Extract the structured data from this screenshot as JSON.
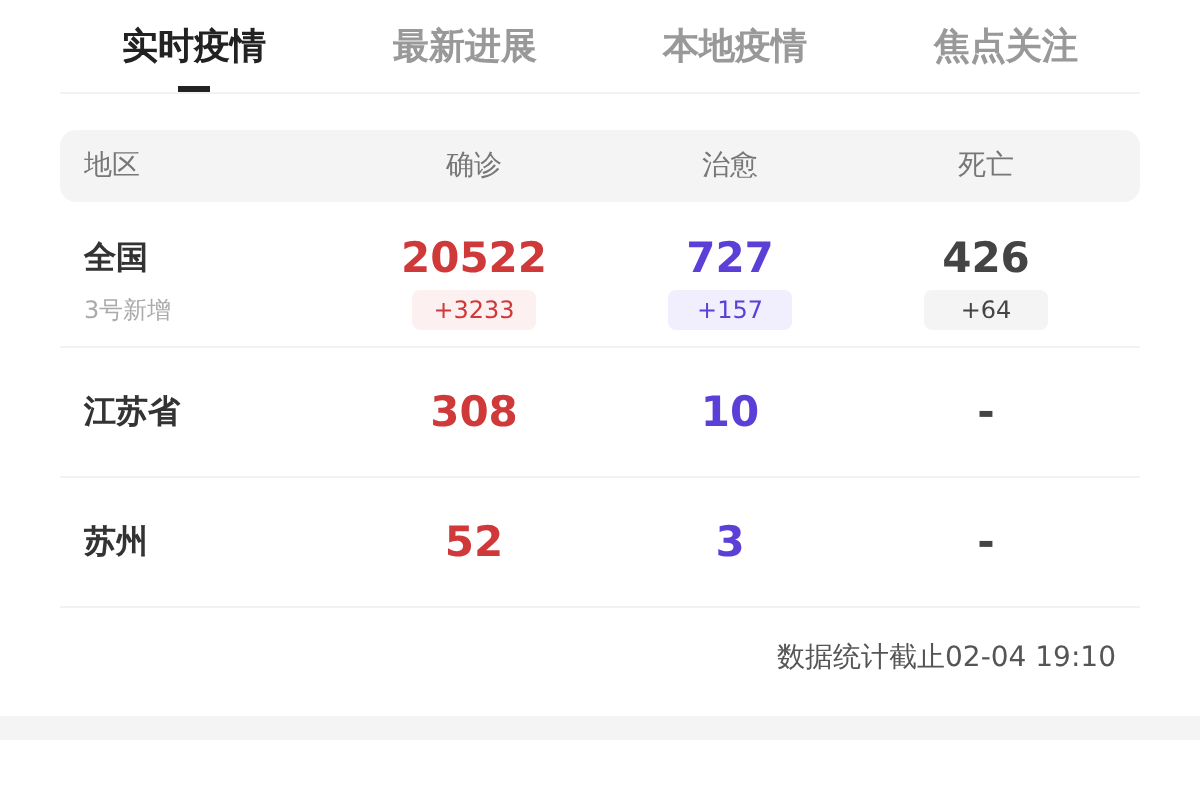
{
  "tabs": [
    {
      "label": "实时疫情",
      "selected": true
    },
    {
      "label": "最新进展",
      "selected": false
    },
    {
      "label": "本地疫情",
      "selected": false
    },
    {
      "label": "焦点关注",
      "selected": false
    }
  ],
  "table": {
    "columns": [
      "地区",
      "确诊",
      "治愈",
      "死亡"
    ],
    "rows": [
      {
        "region": "全国",
        "confirmed": "20522",
        "cured": "727",
        "deaths": "426",
        "sub_label": "3号新增",
        "new_confirmed": "+3233",
        "new_cured": "+157",
        "new_deaths": "+64"
      },
      {
        "region": "江苏省",
        "confirmed": "308",
        "cured": "10",
        "deaths": "-"
      },
      {
        "region": "苏州",
        "confirmed": "52",
        "cured": "3",
        "deaths": "-"
      }
    ]
  },
  "footer_note": "数据统计截止02-04 19:10"
}
